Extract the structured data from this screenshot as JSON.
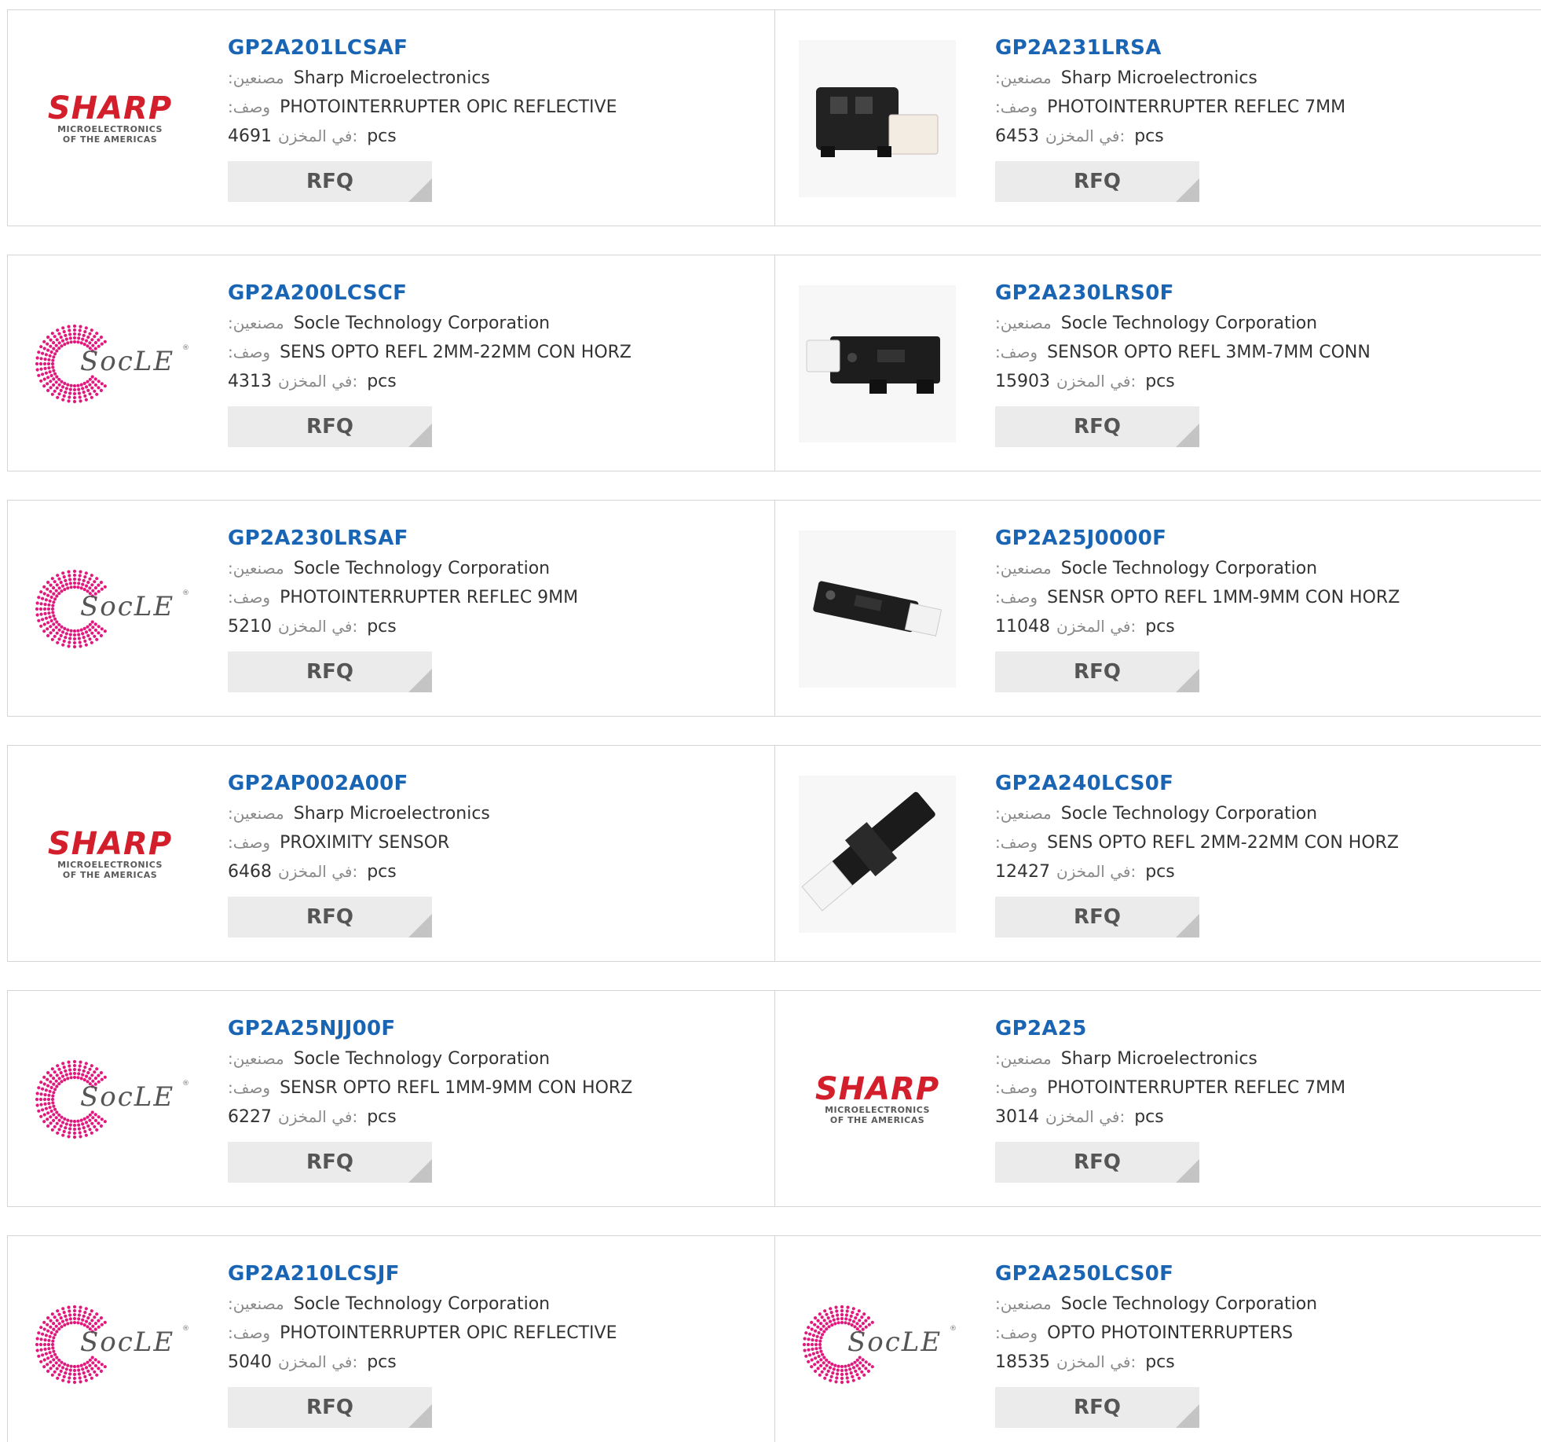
{
  "labels": {
    "manufacturer": ":مصنعين",
    "description": ":وصف",
    "stock": "في المخزن:",
    "pcs": "pcs",
    "rfq": "RFQ"
  },
  "brand_logos": {
    "sharp": {
      "word": "SHARP",
      "sub1": "MICROELECTRONICS",
      "sub2": "OF THE AMERICAS",
      "color": "#d21f2b"
    },
    "socle": {
      "word": "SocLE",
      "reg": "®",
      "color": "#e0197d"
    }
  },
  "products": [
    {
      "part": "GP2A201LCSAF",
      "manufacturer": "Sharp Microelectronics",
      "description": "PHOTOINTERRUPTER OPIC REFLECTIVE",
      "stock": "4691",
      "image": "sharp-logo"
    },
    {
      "part": "GP2A231LRSA",
      "manufacturer": "Sharp Microelectronics",
      "description": "PHOTOINTERRUPTER REFLEC 7MM",
      "stock": "6453",
      "image": "component-photo-black-white-connector"
    },
    {
      "part": "GP2A200LCSCF",
      "manufacturer": "Socle Technology Corporation",
      "description": "SENS OPTO REFL 2MM-22MM CON HORZ",
      "stock": "4313",
      "image": "socle-logo"
    },
    {
      "part": "GP2A230LRS0F",
      "manufacturer": "Socle Technology Corporation",
      "description": "SENSOR OPTO REFL 3MM-7MM CONN",
      "stock": "15903",
      "image": "component-photo-horizontal-sensor"
    },
    {
      "part": "GP2A230LRSAF",
      "manufacturer": "Socle Technology Corporation",
      "description": "PHOTOINTERRUPTER REFLEC 9MM",
      "stock": "5210",
      "image": "socle-logo"
    },
    {
      "part": "GP2A25J0000F",
      "manufacturer": "Socle Technology Corporation",
      "description": "SENSR OPTO REFL 1MM-9MM CON HORZ",
      "stock": "11048",
      "image": "component-photo-angled-sensor"
    },
    {
      "part": "GP2AP002A00F",
      "manufacturer": "Sharp Microelectronics",
      "description": "PROXIMITY SENSOR",
      "stock": "6468",
      "image": "sharp-logo"
    },
    {
      "part": "GP2A240LCS0F",
      "manufacturer": "Socle Technology Corporation",
      "description": "SENS OPTO REFL 2MM-22MM CON HORZ",
      "stock": "12427",
      "image": "component-photo-diagonal-sensor"
    },
    {
      "part": "GP2A25NJJ00F",
      "manufacturer": "Socle Technology Corporation",
      "description": "SENSR OPTO REFL 1MM-9MM CON HORZ",
      "stock": "6227",
      "image": "socle-logo"
    },
    {
      "part": "GP2A25",
      "manufacturer": "Sharp Microelectronics",
      "description": "PHOTOINTERRUPTER REFLEC 7MM",
      "stock": "3014",
      "image": "sharp-logo"
    },
    {
      "part": "GP2A210LCSJF",
      "manufacturer": "Socle Technology Corporation",
      "description": "PHOTOINTERRUPTER OPIC REFLECTIVE",
      "stock": "5040",
      "image": "socle-logo"
    },
    {
      "part": "GP2A250LCS0F",
      "manufacturer": "Socle Technology Corporation",
      "description": "OPTO PHOTOINTERRUPTERS",
      "stock": "18535",
      "image": "socle-logo"
    }
  ]
}
